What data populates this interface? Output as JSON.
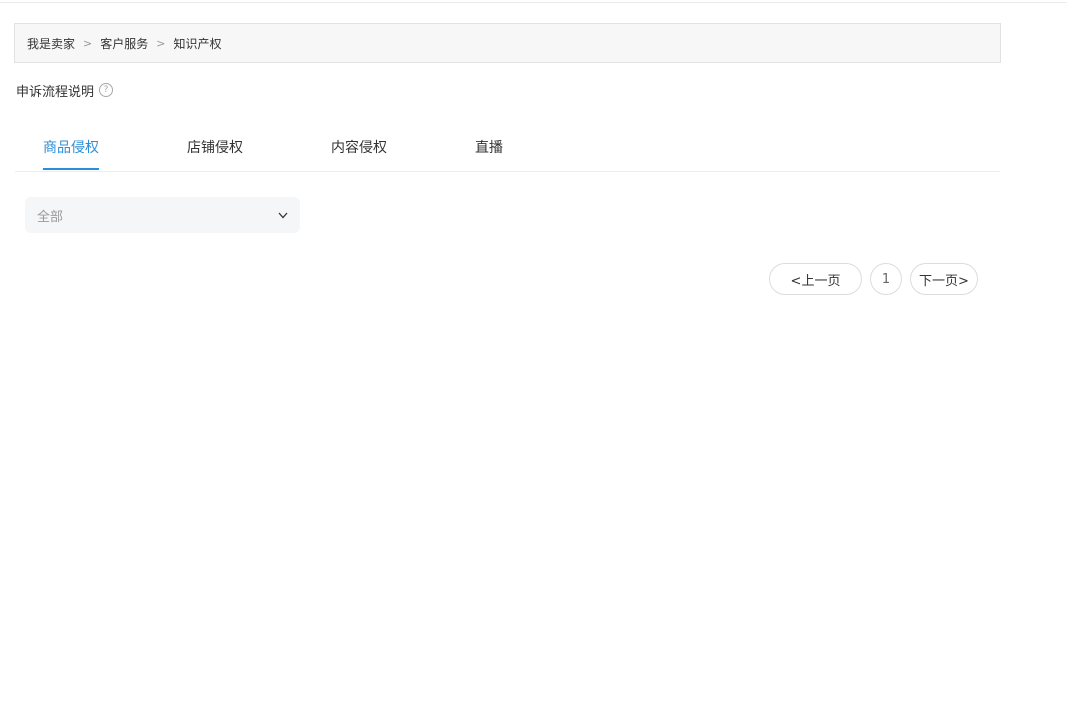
{
  "breadcrumb": {
    "items": [
      "我是卖家",
      "客户服务",
      "知识产权"
    ],
    "separator": ">"
  },
  "appeal": {
    "label": "申诉流程说明",
    "help_icon": "question-circle-icon"
  },
  "tabs": [
    {
      "label": "商品侵权",
      "active": true
    },
    {
      "label": "店铺侵权",
      "active": false
    },
    {
      "label": "内容侵权",
      "active": false
    },
    {
      "label": "直播",
      "active": false
    }
  ],
  "filter": {
    "selected": "全部",
    "icon": "chevron-down-icon"
  },
  "pagination": {
    "prev_label": "<上一页",
    "pages": [
      "1"
    ],
    "next_label": "下一页>"
  },
  "colors": {
    "accent": "#2b8fd8",
    "breadcrumb_bg": "#f7f7f7",
    "select_bg": "#f5f6f8"
  }
}
